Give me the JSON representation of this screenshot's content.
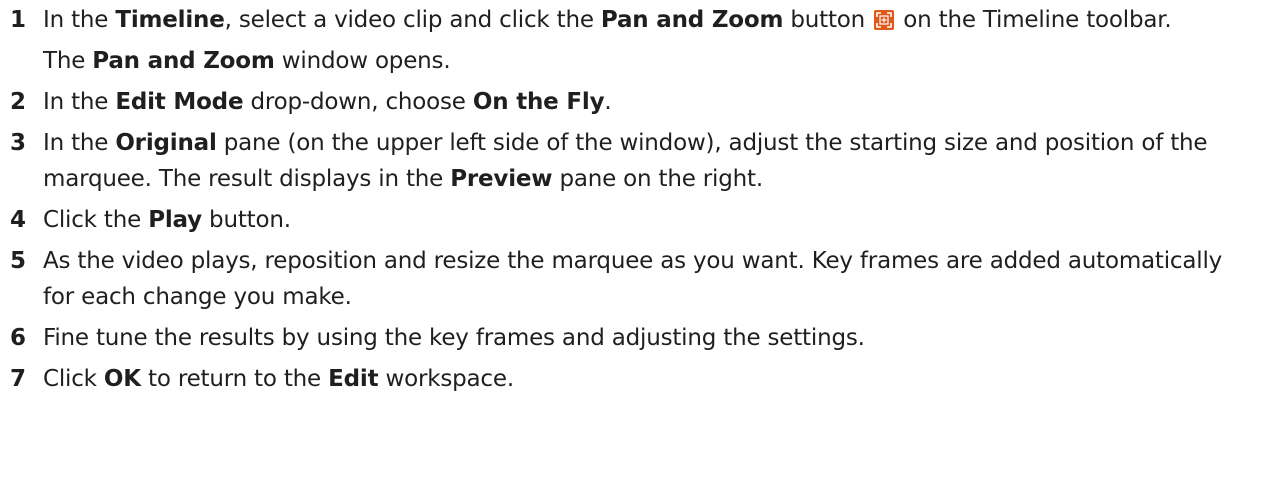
{
  "steps": [
    {
      "number": "1",
      "parts": [
        "In the ",
        "Timeline",
        ", select a video clip and click the ",
        "Pan and Zoom",
        " button ",
        " on the Timeline toolbar."
      ],
      "note": [
        "The ",
        "Pan and Zoom",
        " window opens."
      ]
    },
    {
      "number": "2",
      "parts": [
        "In the ",
        "Edit Mode",
        " drop-down, choose ",
        "On the Fly",
        "."
      ]
    },
    {
      "number": "3",
      "parts": [
        "In the ",
        "Original",
        " pane (on the upper left side of the window), adjust the starting size and position of the marquee. The result displays in the ",
        "Preview",
        " pane on the right."
      ]
    },
    {
      "number": "4",
      "parts": [
        "Click the ",
        "Play",
        " button."
      ]
    },
    {
      "number": "5",
      "parts": [
        "As the video plays, reposition and resize the marquee as you want. Key frames are added automatically for each change you make."
      ]
    },
    {
      "number": "6",
      "parts": [
        "Fine tune the results by using the key frames and adjusting the settings."
      ]
    },
    {
      "number": "7",
      "parts": [
        "Click ",
        "OK",
        " to return to the ",
        "Edit",
        " workspace."
      ]
    }
  ],
  "icons": {
    "pan_zoom_icon": "pan-and-zoom-icon",
    "pan_zoom_color": "#e0581c"
  }
}
